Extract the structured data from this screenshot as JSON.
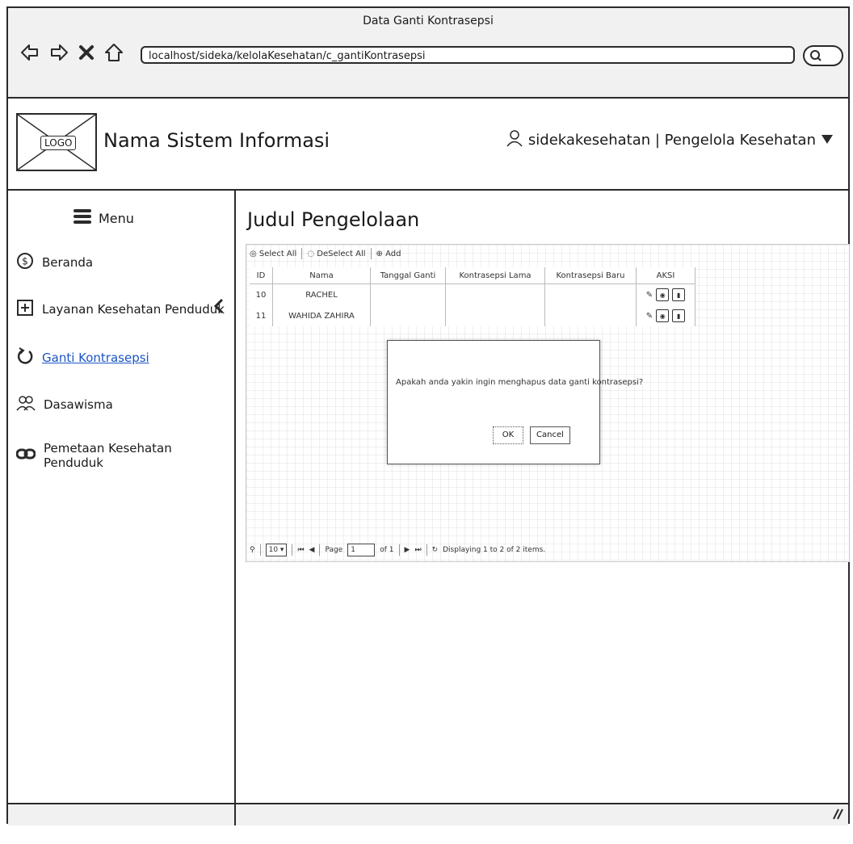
{
  "browser": {
    "window_title": "Data Ganti Kontrasepsi",
    "url": "localhost/sideka/kelolaKesehatan/c_gantiKontrasepsi"
  },
  "header": {
    "logo_label": "LOGO",
    "app_name": "Nama Sistem Informasi",
    "user_label": "sidekakesehatan | Pengelola Kesehatan"
  },
  "sidebar": {
    "menu_label": "Menu",
    "items": [
      {
        "label": "Beranda",
        "icon": "money-circle-icon"
      },
      {
        "label": "Layanan Kesehatan Penduduk",
        "icon": "plus-box-icon"
      },
      {
        "label": "Ganti Kontrasepsi",
        "icon": "refresh-icon",
        "active": true
      },
      {
        "label": "Dasawisma",
        "icon": "group-icon"
      },
      {
        "label": "Pemetaan Kesehatan Penduduk",
        "icon": "link-icon"
      }
    ]
  },
  "main": {
    "page_title": "Judul Pengelolaan",
    "toolbar": {
      "select_all": "Select All",
      "deselect_all": "DeSelect All",
      "add": "Add"
    },
    "table": {
      "columns": [
        "ID",
        "Nama",
        "Tanggal Ganti",
        "Kontrasepsi Lama",
        "Kontrasepsi Baru",
        "AKSI"
      ],
      "rows": [
        [
          "10",
          "RACHEL",
          "",
          "",
          ""
        ],
        [
          "11",
          "WAHIDA ZAHIRA",
          "",
          "",
          ""
        ]
      ]
    },
    "pager": {
      "page_size": "10",
      "page_label": "Page",
      "page_value": "1",
      "of_label": "of 1",
      "display_text": "Displaying 1 to 2 of 2 items."
    },
    "dialog": {
      "message": "Apakah anda yakin ingin menghapus data ganti kontrasepsi?",
      "ok_label": "OK",
      "cancel_label": "Cancel"
    }
  },
  "colors": {
    "active_link": "#1a56c4",
    "chrome_bg": "#f1f1f1",
    "border": "#2a2a2a"
  }
}
